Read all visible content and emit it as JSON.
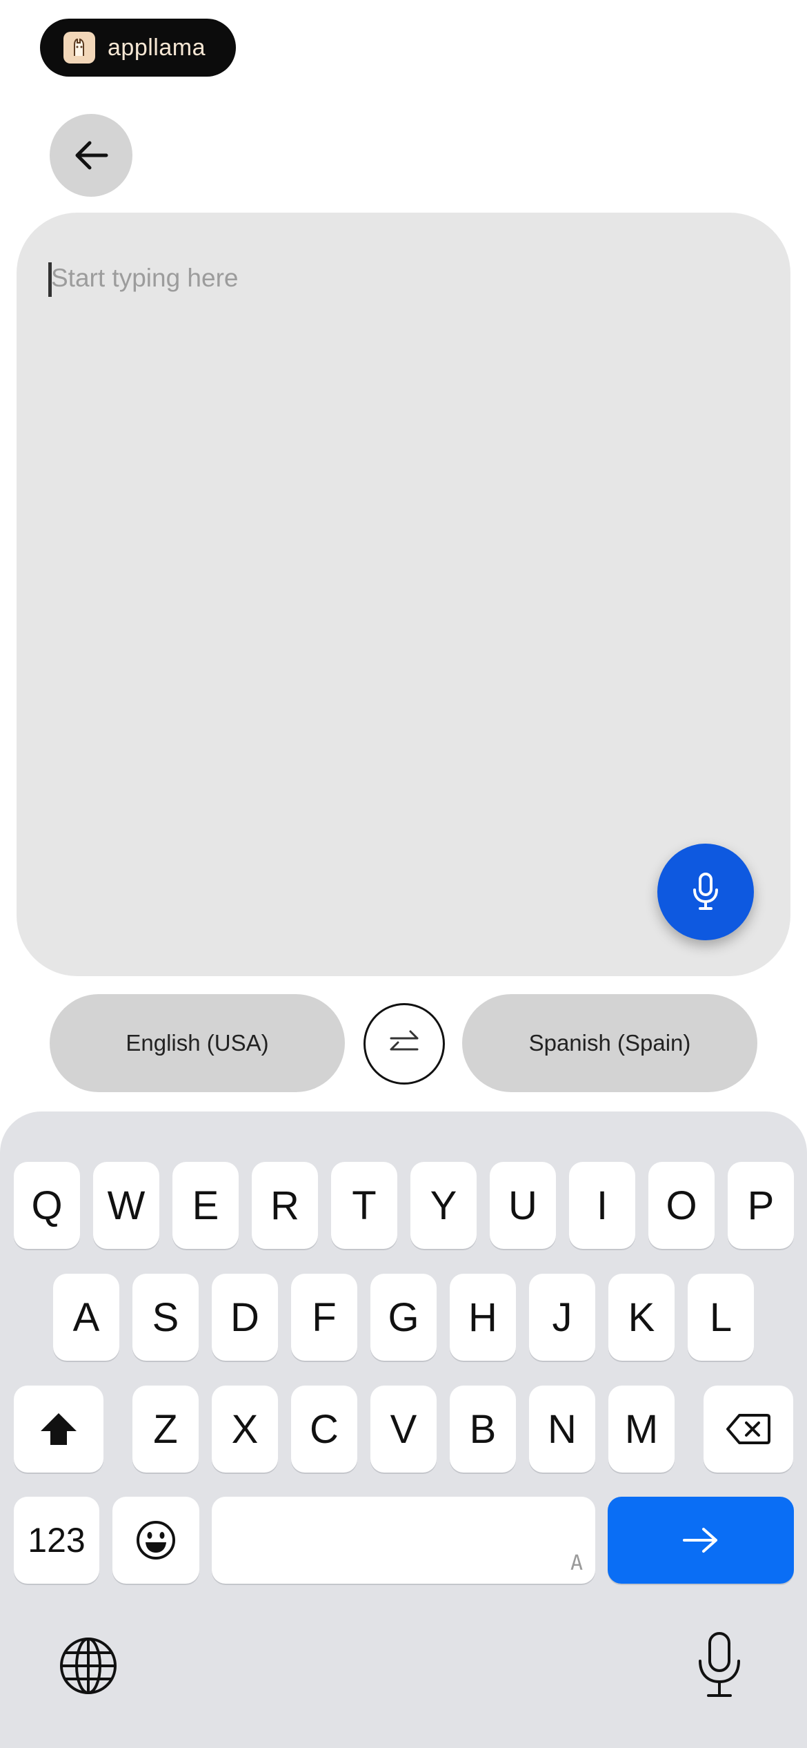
{
  "brand": {
    "name": "appllama"
  },
  "editor": {
    "placeholder": "Start typing here"
  },
  "languages": {
    "source": "English (USA)",
    "target": "Spanish (Spain)"
  },
  "keyboard": {
    "row1": [
      "Q",
      "W",
      "E",
      "R",
      "T",
      "Y",
      "U",
      "I",
      "O",
      "P"
    ],
    "row2": [
      "A",
      "S",
      "D",
      "F",
      "G",
      "H",
      "J",
      "K",
      "L"
    ],
    "row3": [
      "Z",
      "X",
      "C",
      "V",
      "B",
      "N",
      "M"
    ],
    "numbers_key": "123",
    "space_hint": "A"
  },
  "colors": {
    "accent": "#0e59e0",
    "keyboard_bg": "#e1e2e6",
    "return_key": "#0a6ef5"
  }
}
